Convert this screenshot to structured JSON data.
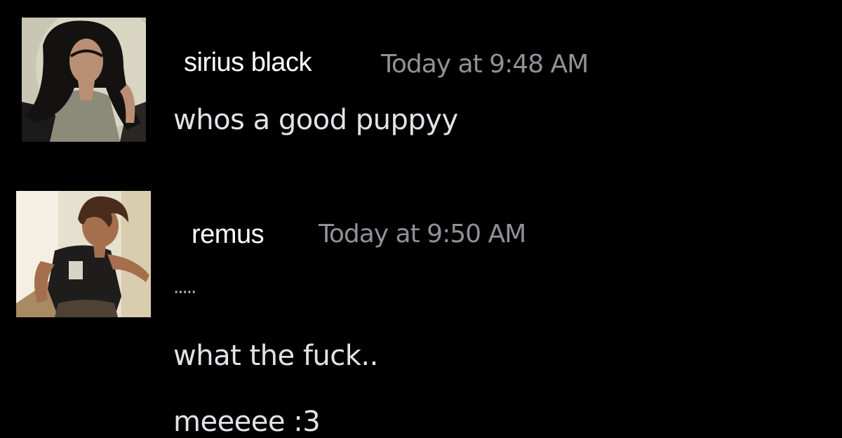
{
  "messages": [
    {
      "author": "sirius black",
      "timestamp": "Today at 9:48 AM",
      "lines": [
        "whos a good puppyy"
      ]
    },
    {
      "author": "remus",
      "timestamp": "Today at 9:50 AM",
      "lines": [
        "·····",
        "what the fuck..",
        "meeeee :3"
      ]
    }
  ],
  "colors": {
    "background": "#000000",
    "author": "#ffffff",
    "timestamp": "#8e9297",
    "message_text": "#e1e3e6"
  }
}
